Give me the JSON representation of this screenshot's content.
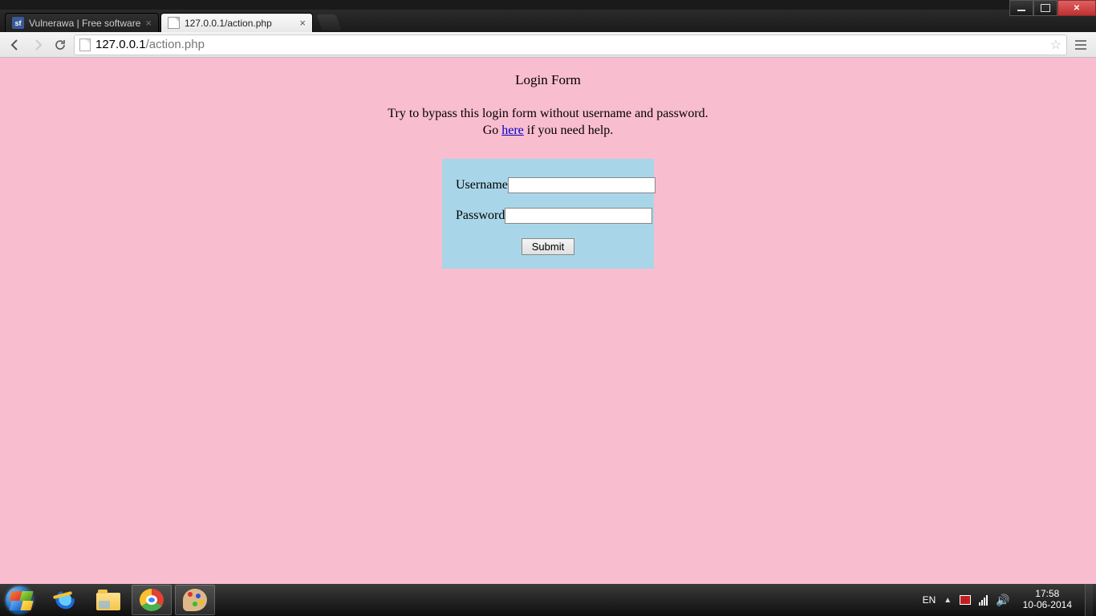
{
  "window": {
    "tabs": [
      {
        "title": "Vulnerawa | Free software",
        "favicon": "sf"
      },
      {
        "title": "127.0.0.1/action.php",
        "favicon": "blank"
      }
    ],
    "active_tab": 1
  },
  "address_bar": {
    "host": "127.0.0.1",
    "path": "/action.php"
  },
  "page": {
    "heading": "Login Form",
    "instruction": "Try to bypass this login form without username and password.",
    "help_prefix": "Go ",
    "help_link": "here",
    "help_suffix": " if you need help.",
    "form": {
      "username_label": "Username",
      "username_value": "",
      "password_label": "Password",
      "password_value": "",
      "submit_label": "Submit"
    }
  },
  "taskbar": {
    "lang": "EN",
    "time": "17:58",
    "date": "10-06-2014"
  }
}
